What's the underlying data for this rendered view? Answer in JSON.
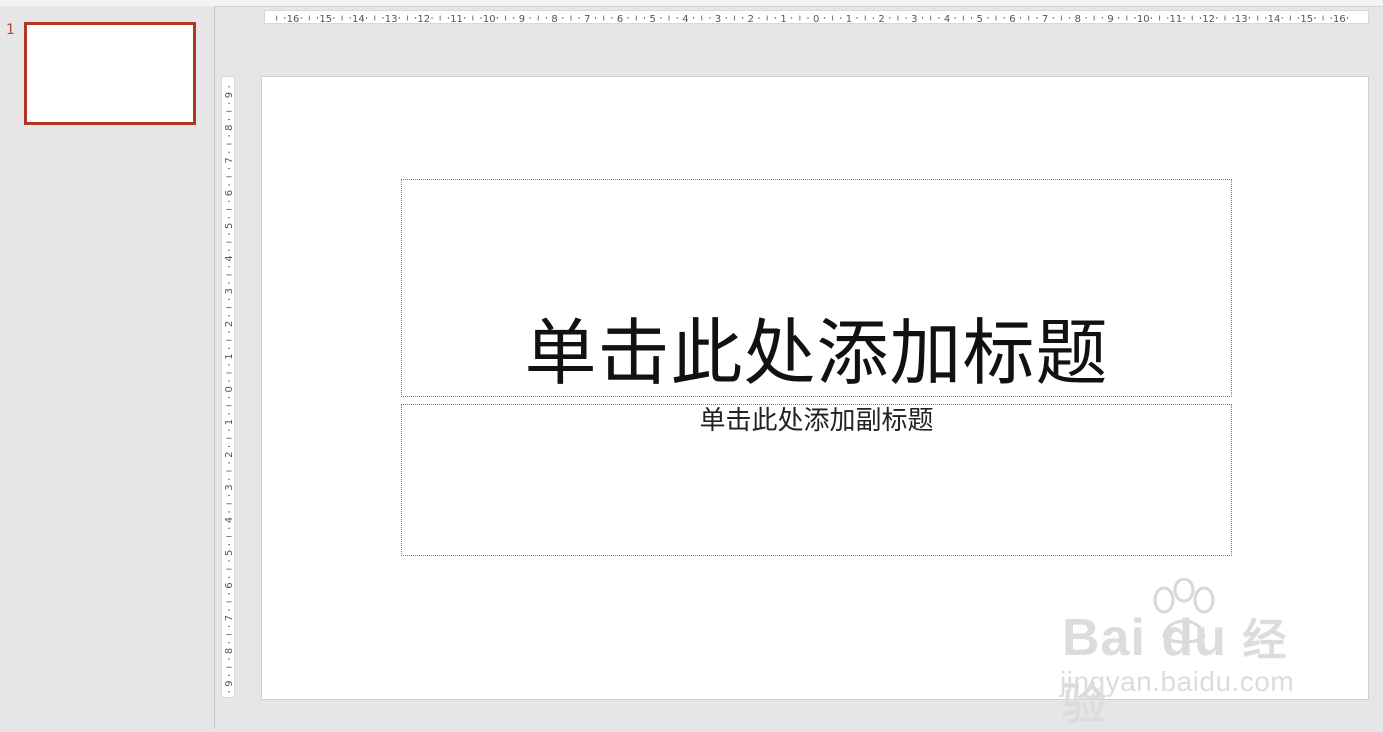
{
  "thumbnails": {
    "slide_number": "1"
  },
  "slide": {
    "title_placeholder": "单击此处添加标题",
    "subtitle_placeholder": "单击此处添加副标题"
  },
  "rulers": {
    "horizontal_labels": [
      "16",
      "15",
      "14",
      "13",
      "12",
      "11",
      "10",
      "9",
      "8",
      "7",
      "6",
      "5",
      "4",
      "3",
      "2",
      "1",
      "0",
      "1",
      "2",
      "3",
      "4",
      "5",
      "6",
      "7",
      "8",
      "9",
      "10",
      "11",
      "12",
      "13",
      "14",
      "15",
      "16"
    ],
    "vertical_labels": [
      "9",
      "8",
      "7",
      "6",
      "5",
      "4",
      "3",
      "2",
      "1",
      "0",
      "1",
      "2",
      "3",
      "4",
      "5",
      "6",
      "7",
      "8",
      "9"
    ]
  },
  "watermark": {
    "brand": "Bai du",
    "brand_cn": "经验",
    "url": "jingyan.baidu.com"
  },
  "colors": {
    "selection_border": "#b03626",
    "workspace": "#e6e6e6",
    "slide_bg": "#ffffff"
  }
}
